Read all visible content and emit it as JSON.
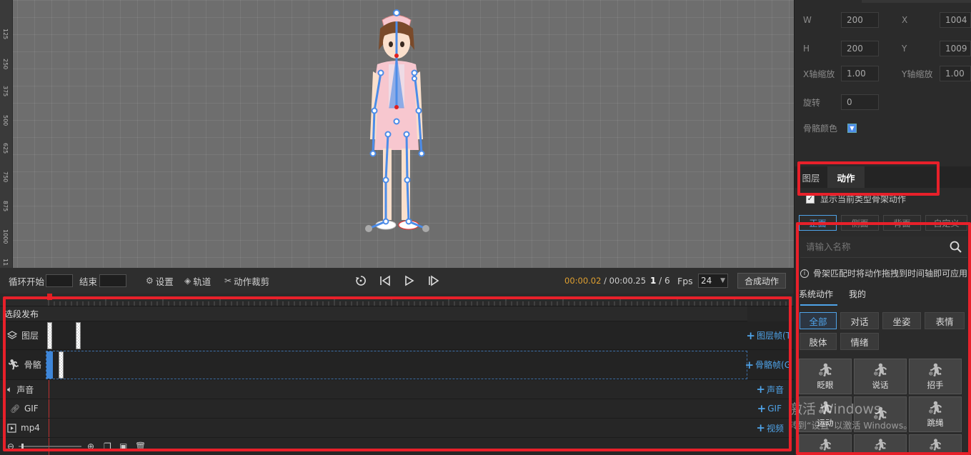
{
  "ruler": {
    "v_ticks": [
      "125",
      "250",
      "375",
      "500",
      "625",
      "750",
      "875",
      "1000",
      "11"
    ]
  },
  "controls": {
    "loop_start_label": "循环开始",
    "end_label": "结束",
    "settings_label": "设置",
    "tracks_label": "轨道",
    "crop_label": "动作裁剪",
    "time_current": "00:00.02",
    "time_sep": " / ",
    "time_total": "00:00.25",
    "frame_current": "1",
    "frame_sep": " / ",
    "frame_total": "6",
    "fps_label": "Fps",
    "fps_value": "24",
    "compose_label": "合成动作"
  },
  "timeline": {
    "segment_label": "选段发布",
    "rows": {
      "layer": {
        "label": "图层",
        "add": "图层帧(T"
      },
      "skeleton": {
        "label": "骨骼",
        "add": "骨骼帧(G"
      },
      "sound": {
        "label": "声音",
        "add": "声音"
      },
      "gif": {
        "label": "GIF",
        "add": "GIF"
      },
      "mp4": {
        "label": "mp4",
        "add": "视频"
      }
    }
  },
  "properties": {
    "w_label": "W",
    "w_value": "200",
    "x_label": "X",
    "x_value": "1004",
    "h_label": "H",
    "h_value": "200",
    "y_label": "Y",
    "y_value": "1009",
    "xscale_label": "X轴缩放",
    "xscale_value": "1.00",
    "yscale_label": "Y轴缩放",
    "yscale_value": "1.00",
    "rotate_label": "旋转",
    "rotate_value": "0",
    "bone_color_label": "骨骼颜色"
  },
  "panel_tabs": {
    "layers": "图层",
    "actions": "动作"
  },
  "actions_panel": {
    "show_current_label": "显示当前类型骨架动作",
    "directions": [
      "正面",
      "侧面",
      "背面",
      "自定义"
    ],
    "search_placeholder": "请输入名称",
    "hint": "骨架匹配时将动作拖拽到时间轴即可应用",
    "source_tabs": [
      "系统动作",
      "我的"
    ],
    "categories": [
      "全部",
      "对话",
      "坐姿",
      "表情",
      "肢体",
      "情绪"
    ],
    "actions": [
      "眨眼",
      "说话",
      "招手",
      "运动",
      "",
      "跳绳",
      "",
      "",
      ""
    ]
  },
  "watermark": {
    "line1": "激活 Windows",
    "line2": "转到“设置”以激活 Windows。"
  },
  "colors": {
    "accent": "#4fa3e8",
    "time": "#e0a030",
    "highlight": "#e8202a"
  }
}
